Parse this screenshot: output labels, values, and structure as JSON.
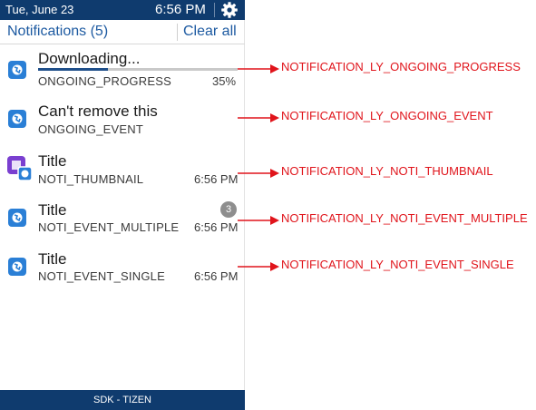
{
  "status_bar": {
    "date": "Tue, June 23",
    "time": "6:56 PM",
    "icon": "gear-icon"
  },
  "header": {
    "title": "Notifications (5)",
    "clear_all": "Clear all"
  },
  "notifications": [
    {
      "title": "Downloading...",
      "subtitle": "ONGOING_PROGRESS",
      "right": "35%",
      "progress": 0.35,
      "icon": "app-globe-icon"
    },
    {
      "title": "Can't remove this",
      "subtitle": "ONGOING_EVENT",
      "right": "",
      "icon": "app-globe-icon"
    },
    {
      "title": "Title",
      "subtitle": "NOTI_THUMBNAIL",
      "right": "6:56 PM",
      "icon": "thumbnail-icon"
    },
    {
      "title": "Title",
      "subtitle": "NOTI_EVENT_MULTIPLE",
      "right": "6:56 PM",
      "badge": "3",
      "icon": "app-globe-icon"
    },
    {
      "title": "Title",
      "subtitle": "NOTI_EVENT_SINGLE",
      "right": "6:56 PM",
      "icon": "app-globe-icon"
    }
  ],
  "footer": "SDK - TIZEN",
  "annotations": [
    "NOTIFICATION_LY_ONGOING_PROGRESS",
    "NOTIFICATION_LY_ONGOING_EVENT",
    "NOTIFICATION_LY_NOTI_THUMBNAIL",
    "NOTIFICATION_LY_NOTI_EVENT_MULTIPLE",
    "NOTIFICATION_LY_NOTI_EVENT_SINGLE"
  ],
  "colors": {
    "bar": "#0f3b6e",
    "accent": "#1d5aa1",
    "annotation": "#e0141b",
    "icon_blue": "#2a7fd6",
    "thumbnail_purple": "#7a3fd0"
  }
}
